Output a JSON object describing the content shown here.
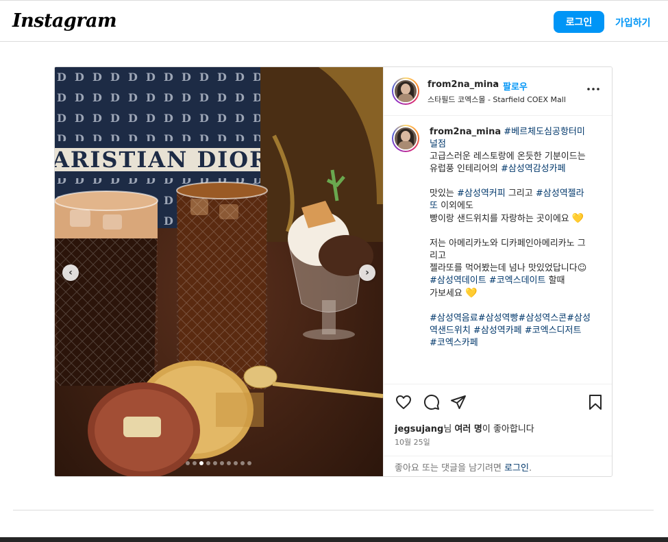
{
  "header": {
    "logo": "Instagram",
    "login_label": "로그인",
    "signup_label": "가입하기"
  },
  "post": {
    "username": "from2na_mina",
    "separator": "•",
    "follow_label": "팔로우",
    "location": "스타필드 코엑스몰 - Starfield COEX Mall",
    "caption": {
      "username": "from2na_mina",
      "l1_tag": "#베르체도심공항터미널점",
      "l2": "고급스러운 레스토랑에 온듯한 기분이드는",
      "l3_text": "유럽풍 인테리어의 ",
      "l3_tag": "#삼성역감성카페",
      "l5_text_a": "맛있는 ",
      "l5_tag_a": "#삼성역커피",
      "l5_text_b": " 그리고 ",
      "l5_tag_b": "#삼성역젤라또",
      "l5_text_c": " 이외에도",
      "l6": "빵이랑 샌드위치를 자랑하는 곳이에요",
      "l6_emoji": "💛",
      "l8": "저는 아메리카노와 디카페인아메리카노 그리고",
      "l9": "젤라또를 먹어봤는데 넘나 맛있었답니다☺︎",
      "l10_tag_a": "#삼성역데이트",
      "l10_tag_b": "#코엑스데이트",
      "l10_text": " 할때",
      "l11": "가보세요 ",
      "l11_emoji": "💛",
      "l13_tags": "#삼성역음료#삼성역빵#삼성역스콘#삼성역샌드위치 #삼성역카페 #코엑스디저트 #코엑스카페"
    },
    "likes_user": "jegsujang",
    "likes_suffix_1": "님 ",
    "likes_bold": "여러 명",
    "likes_suffix_2": "이 좋아합니다",
    "date": "10월 25일",
    "comment_prompt": "좋아요 또는 댓글을 남기려면 ",
    "comment_login": "로그인",
    "comment_period": ".",
    "carousel": {
      "total": 10,
      "active_index": 2
    }
  },
  "icons": {
    "more": "more-horizontal-icon",
    "like": "heart-icon",
    "comment": "comment-icon",
    "share": "paper-plane-icon",
    "save": "bookmark-icon",
    "prev": "chevron-left-icon",
    "next": "chevron-right-icon"
  },
  "colors": {
    "accent": "#0095f6",
    "hashtag": "#00376b",
    "text": "#262626",
    "muted": "#737373",
    "border": "#dbdbdb"
  }
}
